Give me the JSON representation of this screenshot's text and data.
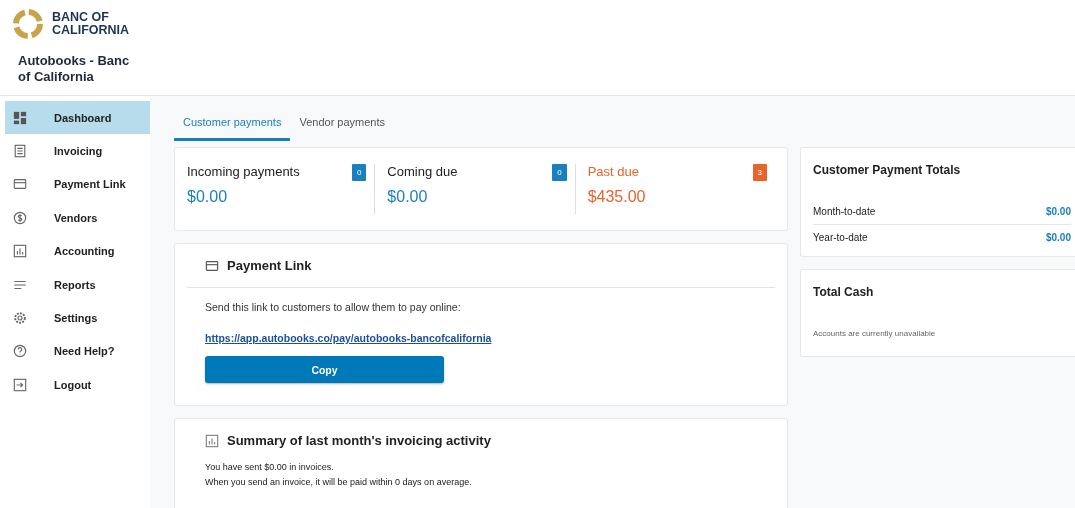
{
  "brand": {
    "logo_text": "BANC OF CALIFORNIA",
    "org_name": "Autobooks - Banc of California"
  },
  "sidebar": {
    "items": [
      {
        "label": "Dashboard",
        "selected": true
      },
      {
        "label": "Invoicing",
        "selected": false
      },
      {
        "label": "Payment Link",
        "selected": false
      },
      {
        "label": "Vendors",
        "selected": false
      },
      {
        "label": "Accounting",
        "selected": false
      },
      {
        "label": "Reports",
        "selected": false
      },
      {
        "label": "Settings",
        "selected": false
      },
      {
        "label": "Need Help?",
        "selected": false
      },
      {
        "label": "Logout",
        "selected": false
      }
    ]
  },
  "tabs": [
    {
      "label": "Customer payments",
      "selected": true
    },
    {
      "label": "Vendor payments",
      "selected": false
    }
  ],
  "stats": [
    {
      "title": "Incoming payments",
      "count": "0",
      "amount": "$0.00",
      "color": "#1a7fbf"
    },
    {
      "title": "Coming due",
      "count": "0",
      "amount": "$0.00",
      "color": "#1a7fbf"
    },
    {
      "title": "Past due",
      "count": "3",
      "amount": "$435.00",
      "color": "#e8642c"
    }
  ],
  "payment_link": {
    "title": "Payment Link",
    "text": "Send this link to customers to allow them to pay online:",
    "link": "https://app.autobooks.co/pay/autobooks-bancofcalifornia",
    "button": "Copy"
  },
  "summary": {
    "title": "Summary of last month's invoicing activity",
    "lines": [
      "You have sent $0.00 in invoices.",
      "When you send an invoice, it will be paid within 0 days on average."
    ]
  },
  "totals": {
    "title": "Customer Payment Totals",
    "rows": [
      {
        "label": "Month-to-date",
        "value": "$0.00"
      },
      {
        "label": "Year-to-date",
        "value": "$0.00"
      }
    ]
  },
  "total_cash": {
    "title": "Total Cash",
    "note": "Accounts are currently unavailable"
  }
}
